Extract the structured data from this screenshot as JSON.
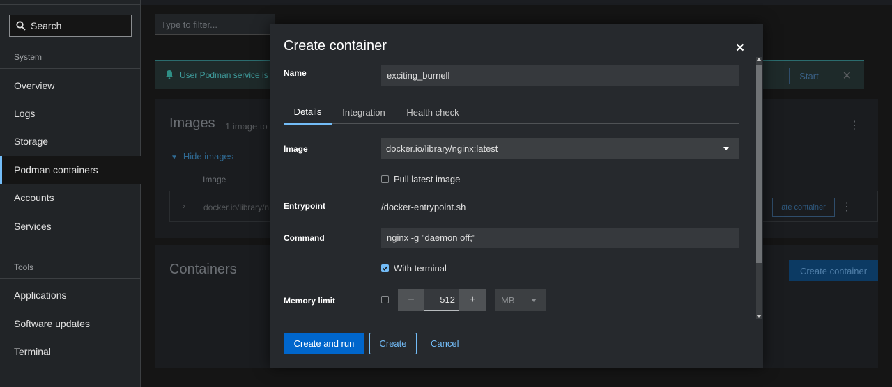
{
  "sidebar": {
    "search_label": "Search",
    "sections": [
      "System",
      "Tools"
    ],
    "items": [
      {
        "label": "Overview"
      },
      {
        "label": "Logs"
      },
      {
        "label": "Storage"
      },
      {
        "label": "Podman containers",
        "active": true
      },
      {
        "label": "Accounts"
      },
      {
        "label": "Services"
      },
      {
        "label": "Applications"
      },
      {
        "label": "Software updates"
      },
      {
        "label": "Terminal"
      }
    ]
  },
  "background": {
    "filter_placeholder": "Type to filter...",
    "alert_text": "User Podman service is",
    "alert_start": "Start",
    "images_title": "Images",
    "images_sub": "1 image to",
    "hide_images": "Hide images",
    "col_image": "Image",
    "image_row_name": "docker.io/library/n",
    "row_create_container": "ate container",
    "containers_title": "Containers",
    "create_container_btn": "Create container"
  },
  "modal": {
    "title": "Create container",
    "name_label": "Name",
    "name_value": "exciting_burnell",
    "tabs": [
      {
        "label": "Details",
        "active": true
      },
      {
        "label": "Integration"
      },
      {
        "label": "Health check"
      }
    ],
    "image_label": "Image",
    "image_value": "docker.io/library/nginx:latest",
    "pull_latest_label": "Pull latest image",
    "pull_latest_checked": false,
    "entrypoint_label": "Entrypoint",
    "entrypoint_value": "/docker-entrypoint.sh",
    "command_label": "Command",
    "command_value": "nginx -g \"daemon off;\"",
    "with_terminal_label": "With terminal",
    "with_terminal_checked": true,
    "memory_label": "Memory limit",
    "memory_enabled": false,
    "memory_value": "512",
    "memory_unit": "MB",
    "minus_symbol": "−",
    "plus_symbol": "+",
    "buttons": {
      "create_and_run": "Create and run",
      "create": "Create",
      "cancel": "Cancel"
    }
  },
  "colors": {
    "accent": "#73bcf7",
    "primary_button": "#0066cc",
    "modal_bg": "#26292d"
  }
}
